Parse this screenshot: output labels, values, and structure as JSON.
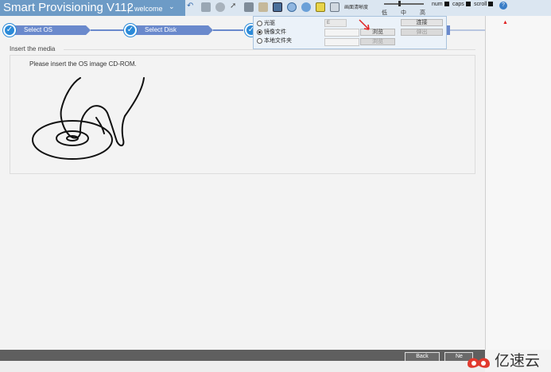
{
  "header": {
    "title": "Smart Provisioning V112",
    "separator": "|",
    "user_menu": "welcome",
    "chevron": "⌄"
  },
  "toolbar": {
    "icons": [
      "undo-icon",
      "keyboard-icon",
      "mouse-icon",
      "pointer-icon",
      "record-icon",
      "link-icon",
      "floppy-icon",
      "cdrom-icon",
      "image-icon",
      "power-icon",
      "display-icon"
    ],
    "resolution_label": "画面清晰度",
    "levels": {
      "low": "低",
      "mid": "中",
      "high": "高"
    },
    "locks": {
      "num": "num",
      "caps": "caps",
      "scroll": "scroll"
    },
    "help": "?"
  },
  "steps": [
    {
      "label": "Select OS",
      "done": true
    },
    {
      "label": "Select Disk",
      "done": true
    },
    {
      "label": "",
      "done": true
    }
  ],
  "popup": {
    "options": [
      {
        "label": "光驱",
        "selected": false
      },
      {
        "label": "镜像文件",
        "selected": true
      },
      {
        "label": "本地文件夹",
        "selected": false
      }
    ],
    "drive_select": "E",
    "connect": "连接",
    "browse": "浏览",
    "eject": "弹出",
    "browse2": "浏览"
  },
  "main": {
    "section_title": "Insert the media",
    "instruction": "Please insert the OS image CD-ROM."
  },
  "footer": {
    "back": "Back",
    "next": "Ne"
  },
  "watermark": {
    "text": "亿速云"
  }
}
